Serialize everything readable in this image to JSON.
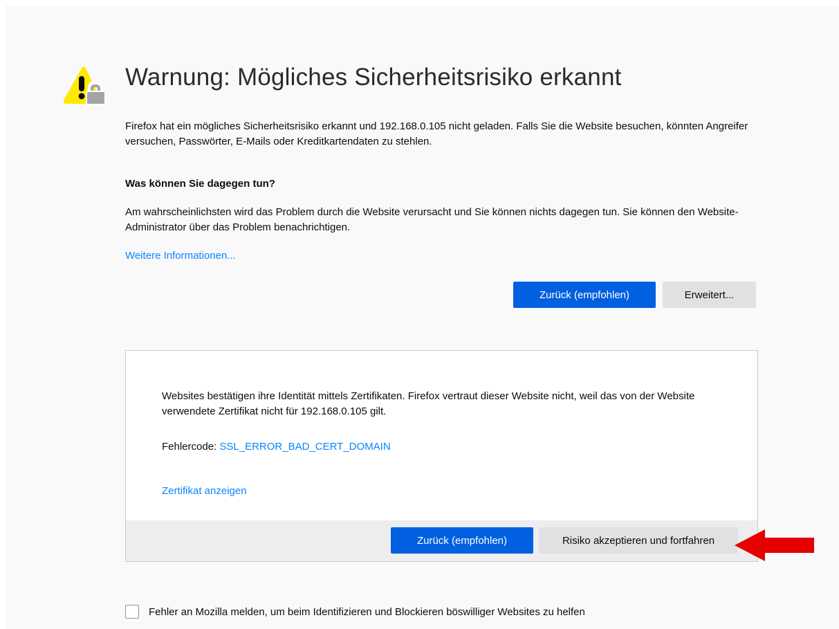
{
  "error_page": {
    "title": "Warnung: Mögliches Sicherheitsrisiko erkannt",
    "intro": "Firefox hat ein mögliches Sicherheitsrisiko erkannt und 192.168.0.105 nicht geladen. Falls Sie die Website besuchen, könnten Angreifer versuchen, Passwörter, E-Mails oder Kreditkartendaten zu stehlen.",
    "what_can_you_do_heading": "Was können Sie dagegen tun?",
    "what_can_you_do_text": "Am wahrscheinlichsten wird das Problem durch die Website verursacht und Sie können nichts dagegen tun. Sie können den Website-Administrator über das Problem benachrichtigen.",
    "more_info_link": "Weitere Informationen...",
    "back_button": "Zurück (empfohlen)",
    "advanced_button": "Erweitert..."
  },
  "advanced_panel": {
    "explanation": "Websites bestätigen ihre Identität mittels Zertifikaten. Firefox vertraut dieser Website nicht, weil das von der Website verwendete Zertifikat nicht für 192.168.0.105 gilt.",
    "error_code_label": "Fehlercode: ",
    "error_code": "SSL_ERROR_BAD_CERT_DOMAIN",
    "view_certificate_link": "Zertifikat anzeigen",
    "back_button": "Zurück (empfohlen)",
    "accept_button": "Risiko akzeptieren und fortfahren"
  },
  "report": {
    "checked": false,
    "label": "Fehler an Mozilla melden, um beim Identifizieren und Blockieren böswilliger Websites zu helfen"
  },
  "colors": {
    "primary_button": "#0060df",
    "link": "#0a84ff",
    "warning_yellow": "#ffe900",
    "annotation_arrow": "#e60000"
  },
  "icons": {
    "warning": "warning-lock-icon",
    "annotation": "red-arrow-icon"
  }
}
